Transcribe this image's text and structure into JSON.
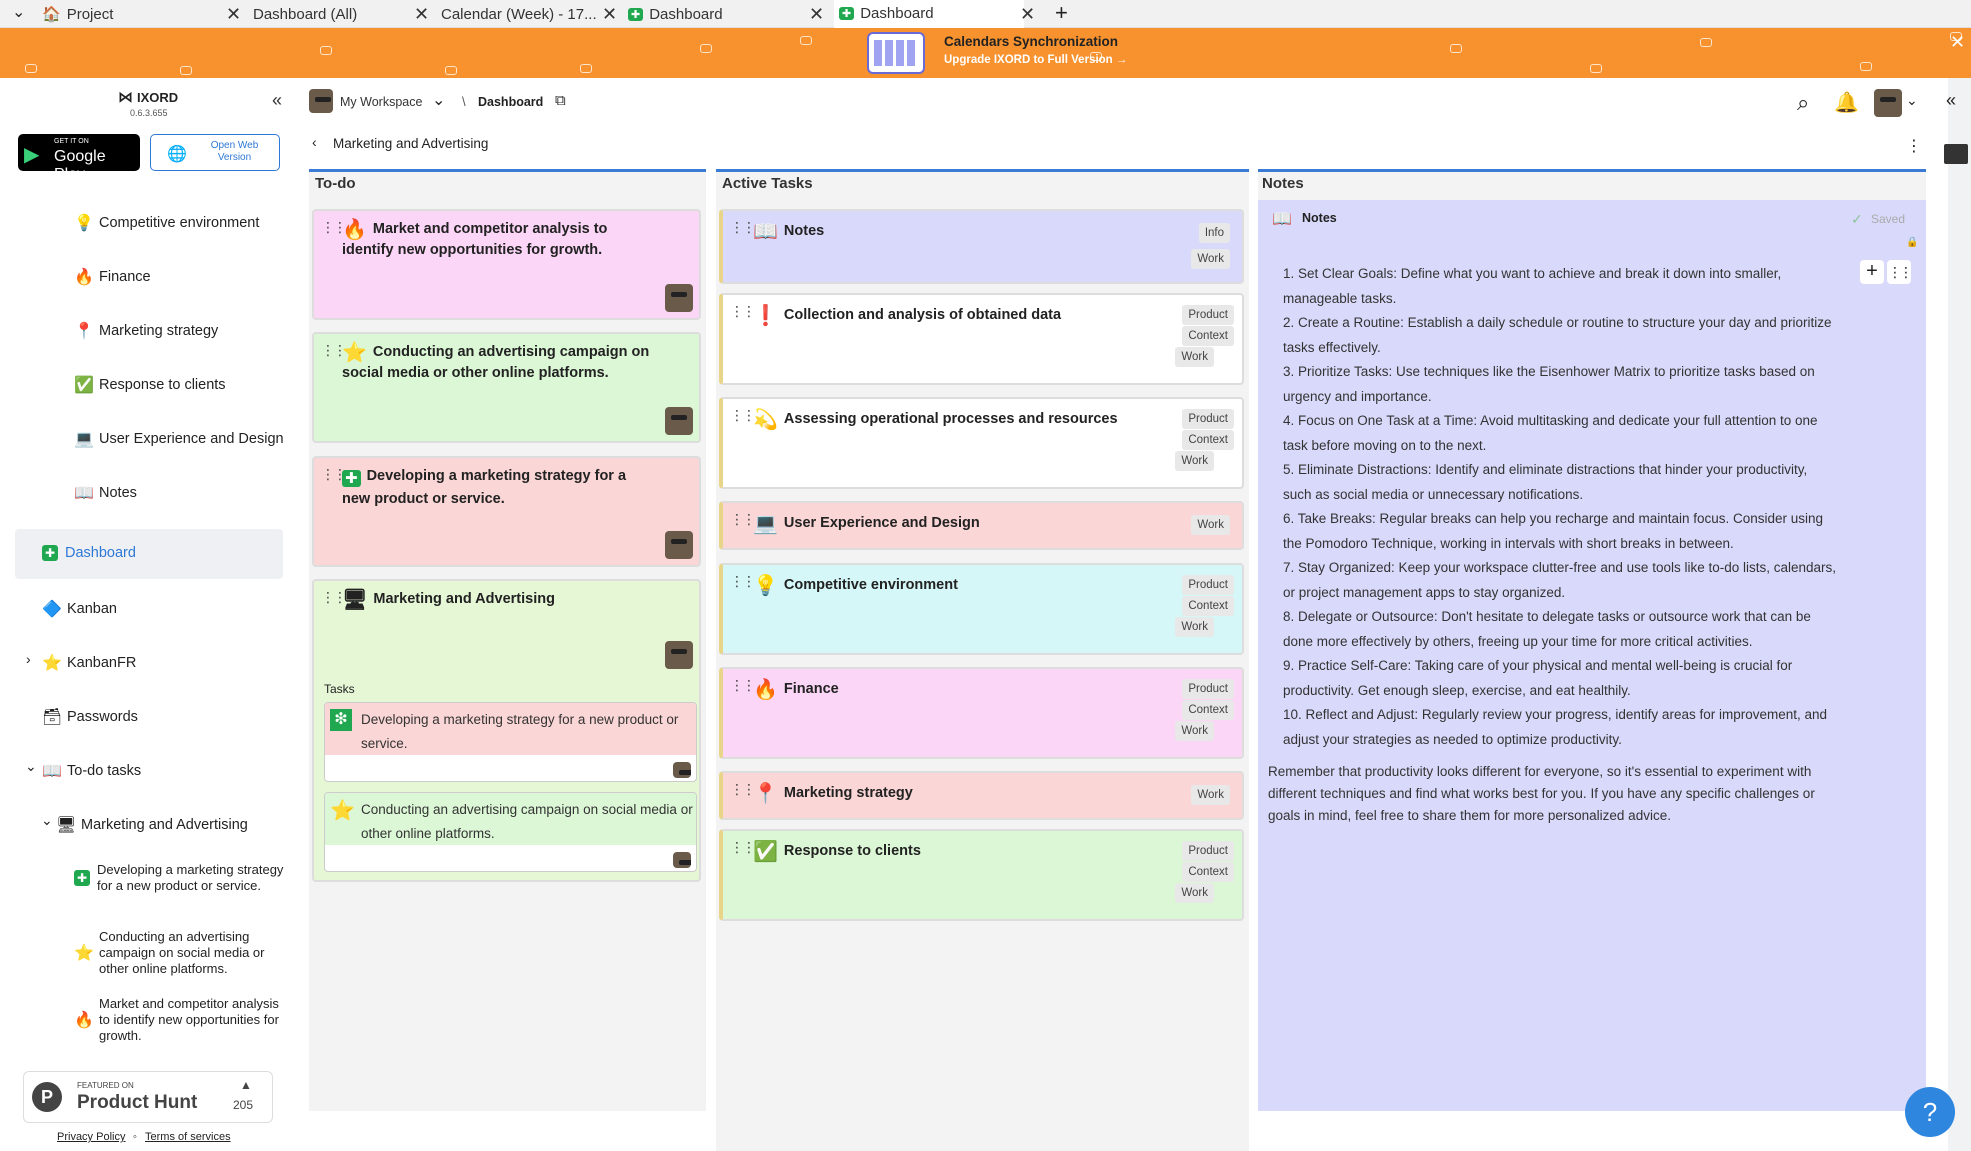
{
  "tabs": [
    {
      "label": "Project",
      "icon": "home-icon"
    },
    {
      "label": "Dashboard (All)"
    },
    {
      "label": "Calendar (Week) - 17..."
    },
    {
      "label": "Dashboard",
      "icon": "dashboard-icon"
    },
    {
      "label": "Dashboard",
      "icon": "dashboard-icon"
    }
  ],
  "banner": {
    "title": "Calendars Synchronization",
    "subtitle": "Upgrade IXORD to Full Version →",
    "bg": "#f7922e"
  },
  "sidebar": {
    "app_name": "IXORD",
    "version": "0.6.3.655",
    "google_play_small": "GET IT ON",
    "google_play_big": "Google Play",
    "open_web": "Open Web Version",
    "items": [
      {
        "label": "Competitive environment",
        "icon": "💡"
      },
      {
        "label": "Finance",
        "icon": "🔥"
      },
      {
        "label": "Marketing strategy",
        "icon": "📍"
      },
      {
        "label": "Response to clients",
        "icon": "✅"
      },
      {
        "label": "User Experience and Design",
        "icon": "💻"
      },
      {
        "label": "Notes",
        "icon": "📖"
      },
      {
        "label": "Dashboard",
        "icon": "✚"
      },
      {
        "label": "Kanban",
        "icon": "🔷"
      },
      {
        "label": "KanbanFR",
        "icon": "⭐"
      },
      {
        "label": "Passwords",
        "icon": "🗃"
      },
      {
        "label": "To-do tasks",
        "icon": "📖"
      },
      {
        "label": "Marketing and Advertising",
        "icon": "🖥"
      },
      {
        "label": "Developing a marketing strategy for a new product or service.",
        "icon": "✚"
      },
      {
        "label": "Conducting an advertising campaign on social media or other online platforms.",
        "icon": "⭐"
      },
      {
        "label": "Market and competitor analysis to identify new opportunities for growth.",
        "icon": "🔥"
      }
    ],
    "ph_small": "FEATURED ON",
    "ph_big": "Product Hunt",
    "ph_count": "205",
    "privacy": "Privacy Policy",
    "terms": "Terms of services"
  },
  "header": {
    "workspace": "My Workspace",
    "separator": "\\",
    "page": "Dashboard",
    "breadcrumb": "Marketing and Advertising"
  },
  "todo": {
    "title": "To-do",
    "cards": [
      {
        "title": "Market and competitor analysis to identify new opportunities for growth.",
        "icon": "🔥",
        "bg": "#fbd6f6"
      },
      {
        "title": "Conducting an advertising campaign on social media or other online platforms.",
        "icon": "⭐",
        "bg": "#dcf7d6"
      },
      {
        "title": "Developing a marketing strategy for a new product or service.",
        "icon": "✚",
        "bg": "#fbd6d6"
      },
      {
        "title": "Marketing and Advertising",
        "icon": "🖥",
        "bg": "#e6f7d6"
      }
    ],
    "tasks_label": "Tasks",
    "subtasks": [
      {
        "title": "Developing a marketing strategy for a new product or service.",
        "icon": "❇",
        "bg": "#fbd6d6"
      },
      {
        "title": "Conducting an advertising campaign on social media or other online platforms.",
        "icon": "⭐",
        "bg": "#dcf7d6"
      }
    ]
  },
  "active": {
    "title": "Active Tasks",
    "cards": [
      {
        "title": "Notes",
        "icon": "📖",
        "bg": "#d9dafb",
        "tags": [
          "Info",
          "Work"
        ]
      },
      {
        "title": "Collection and analysis of obtained data",
        "icon": "❗",
        "bg": "#ffffff",
        "tags": [
          "Product",
          "Context",
          "Work"
        ]
      },
      {
        "title": "Assessing operational processes and resources",
        "icon": "💫",
        "bg": "#ffffff",
        "tags": [
          "Product",
          "Context",
          "Work"
        ]
      },
      {
        "title": "User Experience and Design",
        "icon": "💻",
        "bg": "#fbd6d6",
        "tags": [
          "Work"
        ]
      },
      {
        "title": "Competitive environment",
        "icon": "💡",
        "bg": "#d6f7f7",
        "tags": [
          "Product",
          "Context",
          "Work"
        ]
      },
      {
        "title": "Finance",
        "icon": "🔥",
        "bg": "#fbd6f6",
        "tags": [
          "Product",
          "Context",
          "Work"
        ]
      },
      {
        "title": "Marketing strategy",
        "icon": "📍",
        "bg": "#fbd6d6",
        "tags": [
          "Work"
        ]
      },
      {
        "title": "Response to clients",
        "icon": "✅",
        "bg": "#dcf7d6",
        "tags": [
          "Product",
          "Context",
          "Work"
        ]
      }
    ]
  },
  "notes": {
    "title": "Notes",
    "card_title": "Notes",
    "saved": "Saved",
    "bg": "#d9dafb",
    "items": [
      "1.  Set Clear Goals: Define what you want to achieve and break it down into smaller,",
      "manageable tasks.",
      "2.  Create a Routine: Establish a daily schedule or routine to structure your day and prioritize",
      "tasks effectively.",
      "3.  Prioritize Tasks: Use techniques like the Eisenhower Matrix to prioritize tasks based on",
      "urgency and importance.",
      "4.  Focus on One Task at a Time: Avoid multitasking and dedicate your full attention to one",
      "task before moving on to the next.",
      "5.  Eliminate Distractions: Identify and eliminate distractions that hinder your productivity,",
      "such as social media or unnecessary notifications.",
      "6.  Take Breaks: Regular breaks can help you recharge and maintain focus. Consider using",
      "the Pomodoro Technique, working in intervals with short breaks in between.",
      "7.  Stay Organized: Keep your workspace clutter-free and use tools like to-do lists, calendars,",
      "or project management apps to stay organized.",
      "8.  Delegate or Outsource: Don't hesitate to delegate tasks or outsource work that can be",
      "done more effectively by others, freeing up your time for more critical activities.",
      "9.  Practice Self-Care: Taking care of your physical and mental well-being is crucial for",
      "productivity. Get enough sleep, exercise, and eat healthily.",
      "10.  Reflect and Adjust: Regularly review your progress, identify areas for improvement, and",
      "adjust your strategies as needed to optimize productivity."
    ],
    "outro": [
      "Remember that productivity looks different for everyone, so it's essential to experiment with",
      "different techniques and find what works best for you. If you have any specific challenges or",
      "goals in mind, feel free to share them for more personalized advice."
    ]
  },
  "help_label": "?"
}
